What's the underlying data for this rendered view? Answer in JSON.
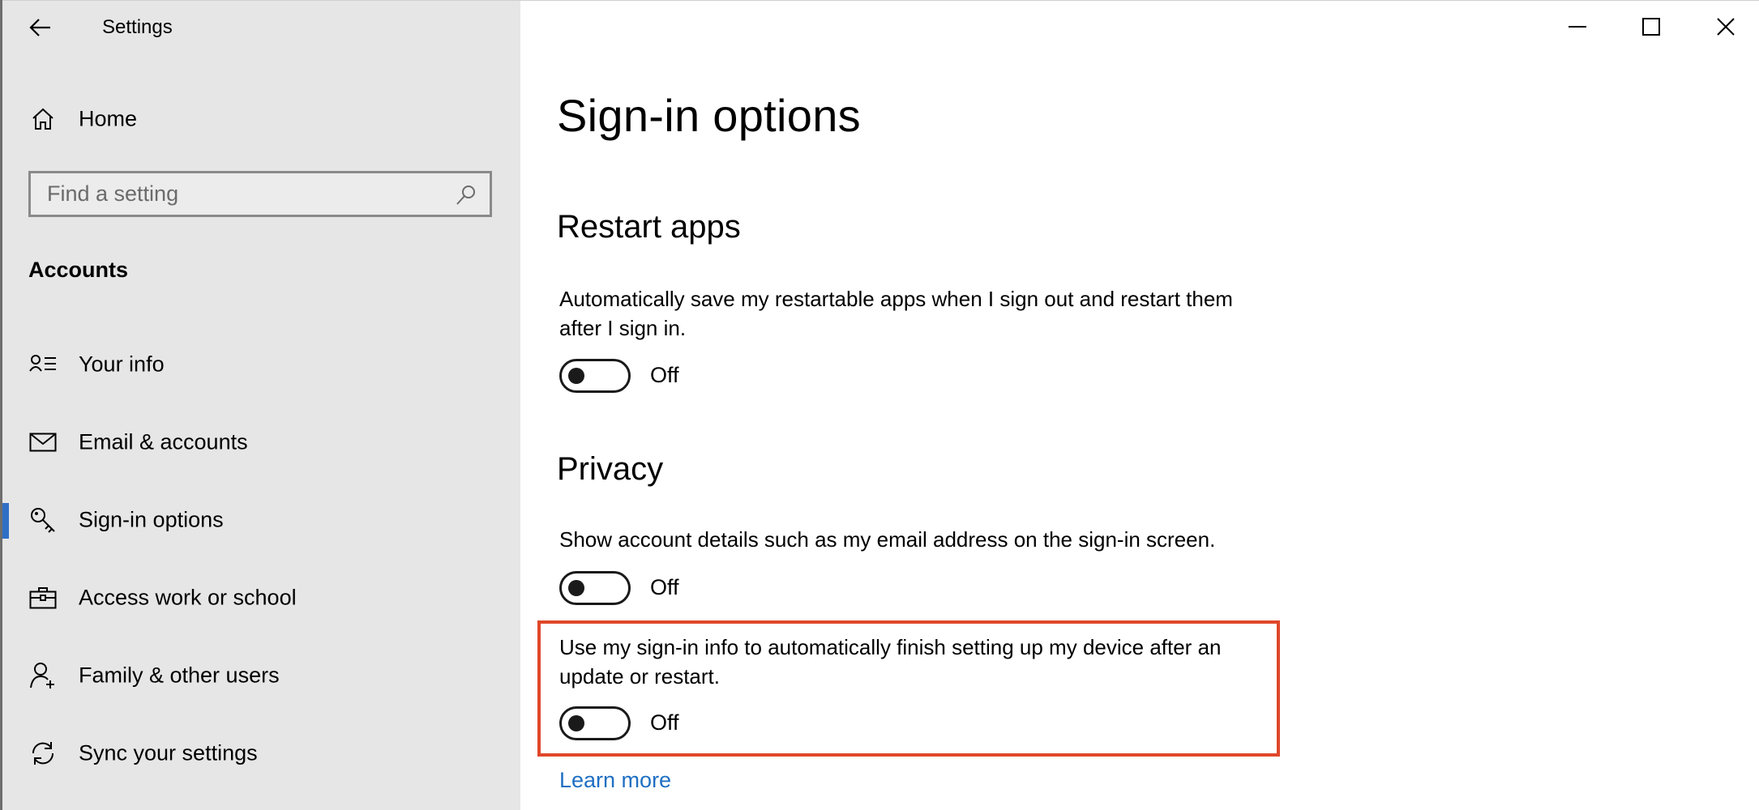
{
  "app": {
    "title": "Settings"
  },
  "sidebar": {
    "home_label": "Home",
    "search": {
      "placeholder": "Find a setting",
      "value": ""
    },
    "group_title": "Accounts",
    "items": [
      {
        "label": "Your info",
        "icon": "person-list-icon",
        "selected": false
      },
      {
        "label": "Email & accounts",
        "icon": "mail-icon",
        "selected": false
      },
      {
        "label": "Sign-in options",
        "icon": "key-icon",
        "selected": true
      },
      {
        "label": "Access work or school",
        "icon": "briefcase-icon",
        "selected": false
      },
      {
        "label": "Family & other users",
        "icon": "person-add-icon",
        "selected": false
      },
      {
        "label": "Sync your settings",
        "icon": "sync-icon",
        "selected": false
      }
    ]
  },
  "main": {
    "page_title": "Sign-in options",
    "restart_apps": {
      "title": "Restart apps",
      "description": "Automatically save my restartable apps when I sign out and restart them after I sign in.",
      "toggle_state": "Off"
    },
    "privacy": {
      "title": "Privacy",
      "show_account_details": {
        "description": "Show account details such as my email address on the sign-in screen.",
        "toggle_state": "Off"
      },
      "use_signin_info": {
        "description": "Use my sign-in info to automatically finish setting up my device after an update or restart.",
        "toggle_state": "Off"
      }
    },
    "learn_more": "Learn more"
  },
  "colors": {
    "accent": "#2f6fc6",
    "link": "#1f6fc2",
    "highlight": "#e0472a",
    "sidebar_bg": "#e6e6e6"
  }
}
